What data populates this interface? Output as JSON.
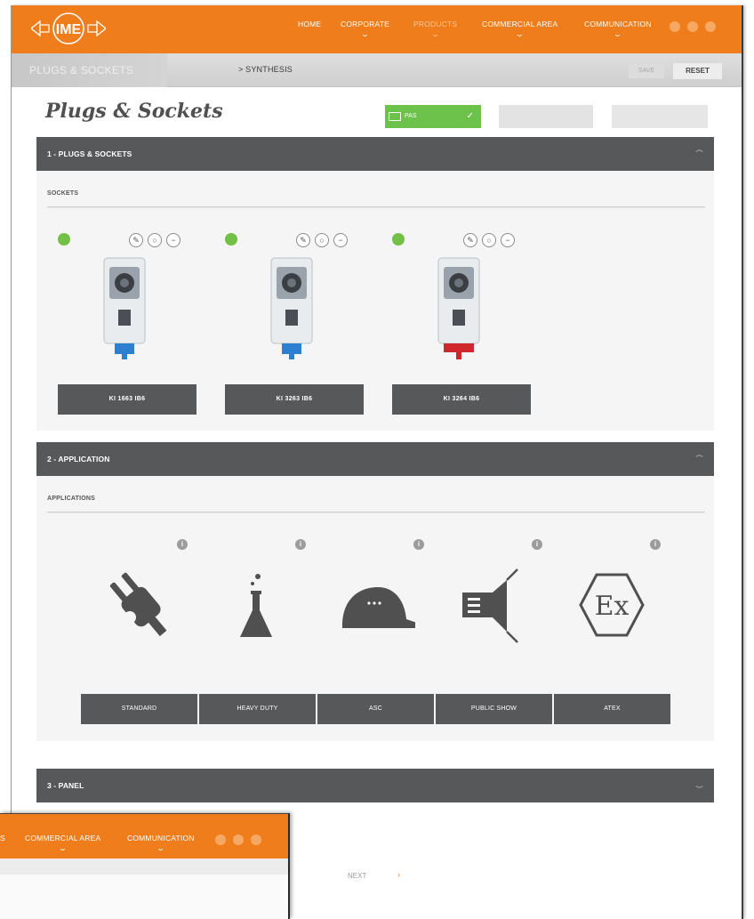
{
  "header": {
    "logo_text": "IME",
    "tagline": "",
    "nav": [
      {
        "label": "HOME",
        "has_menu": false
      },
      {
        "label": "CORPORATE",
        "has_menu": true
      },
      {
        "label": "PRODUCTS",
        "has_menu": true
      },
      {
        "label": "COMMERCIAL AREA",
        "has_menu": true
      },
      {
        "label": "COMMUNICATION",
        "has_menu": true
      }
    ],
    "social_icons": [
      "facebook-icon",
      "linkedin-icon",
      "youtube-icon"
    ]
  },
  "breadcrumb": {
    "section": "PLUGS & SOCKETS",
    "current": "> SYNTHESIS",
    "save_label": "SAVE",
    "reset_label": "RESET"
  },
  "page": {
    "title": "Plugs & Sockets",
    "steps": [
      {
        "label": "PAS",
        "state": "complete"
      },
      {
        "label": "",
        "state": "disabled"
      },
      {
        "label": "",
        "state": "disabled"
      }
    ]
  },
  "sections": [
    {
      "title": "1 - PLUGS & SOCKETS",
      "expanded": true,
      "subtitle": "SOCKETS"
    },
    {
      "title": "2 - APPLICATION",
      "expanded": true,
      "subtitle": "APPLICATIONS"
    },
    {
      "title": "3 - PANEL",
      "expanded": false
    }
  ],
  "products": [
    {
      "name": "KI 1663 IB6",
      "selected": true,
      "plug_color": "#2f7fd0"
    },
    {
      "name": "KI 3263 IB6",
      "selected": true,
      "plug_color": "#2f7fd0"
    },
    {
      "name": "KI 3264 IB6",
      "selected": true,
      "plug_color": "#d0272d"
    }
  ],
  "product_tools": [
    "wrench-icon",
    "copy-icon",
    "remove-icon"
  ],
  "applications": [
    {
      "label": "STANDARD",
      "icon": "plug-icon"
    },
    {
      "label": "HEAVY DUTY",
      "icon": "flask-icon"
    },
    {
      "label": "ASC",
      "icon": "helmet-icon"
    },
    {
      "label": "PUBLIC SHOW",
      "icon": "speaker-icon"
    },
    {
      "label": "ATEX",
      "icon": "ex-hexagon-icon"
    }
  ],
  "footer": {
    "next_label": "NEXT"
  },
  "inset": {
    "nav": [
      {
        "label": "COMMERCIAL AREA"
      },
      {
        "label": "COMMUNICATION"
      }
    ],
    "fragment": "S"
  },
  "colors": {
    "brand_orange": "#ef7d1b",
    "bar_grey": "#56585a",
    "selected_green": "#72c045",
    "step_green": "#6cc24a"
  }
}
